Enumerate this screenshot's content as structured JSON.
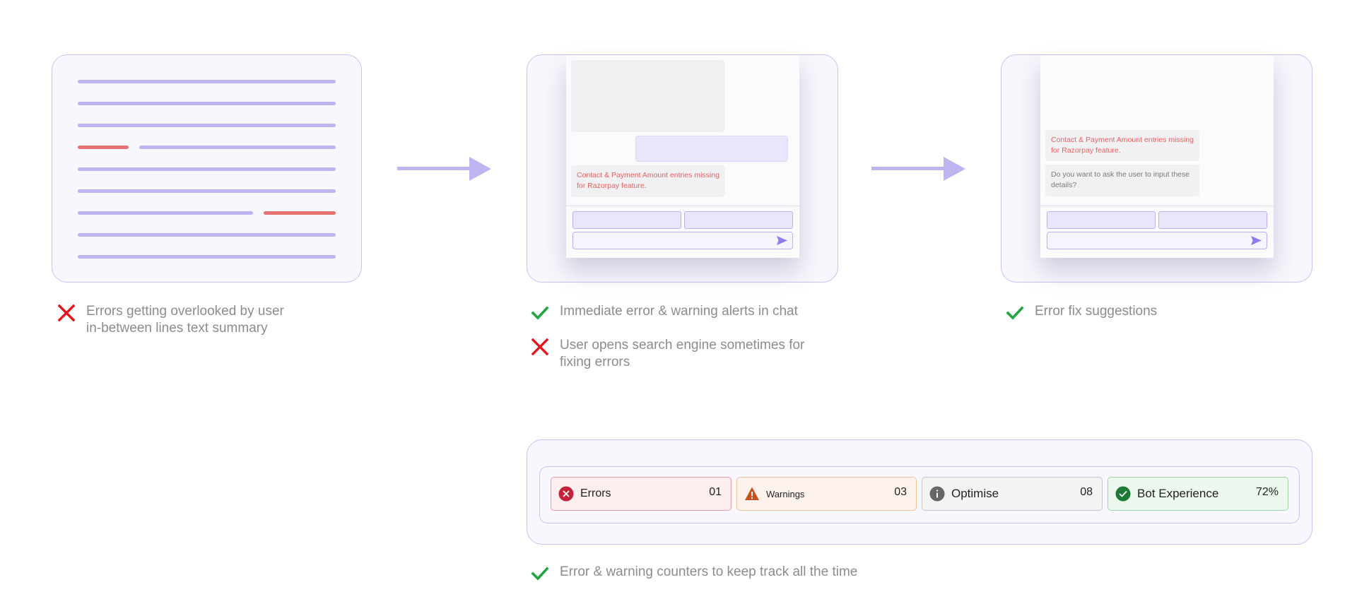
{
  "step1": {
    "note": {
      "icon": "cross-icon",
      "text_line1": "Errors getting overlooked by user",
      "text_line2": "in-between lines text summary"
    }
  },
  "step2": {
    "chat_message": "Contact & Payment Amount entries missing for Razorpay feature.",
    "notes": [
      {
        "icon": "check-icon",
        "text_line1": "Immediate error & warning alerts in chat",
        "text_line2": ""
      },
      {
        "icon": "cross-icon",
        "text_line1": "User opens search engine sometimes for",
        "text_line2": "fixing errors"
      }
    ]
  },
  "step3": {
    "chat_message": "Contact & Payment Amount entries missing for Razorpay feature.",
    "chat_question": "Do you want to ask the user to input these details?",
    "note": {
      "icon": "check-icon",
      "text_line1": "Error fix suggestions"
    }
  },
  "counters": {
    "items": [
      {
        "label": "Errors",
        "value": "01",
        "icon": "error-circle-icon",
        "bg": "#fdeef0",
        "border": "#ec9aa4",
        "icon_color": "#c4213a"
      },
      {
        "label": "Warnings",
        "value": "03",
        "icon": "warning-triangle-icon",
        "bg": "#fdf3ec",
        "border": "#f1c39f",
        "icon_color": "#c8501c"
      },
      {
        "label": "Optimise",
        "value": "08",
        "icon": "info-circle-icon",
        "bg": "#f3f3f4",
        "border": "#c7c7cc",
        "icon_color": "#666666"
      },
      {
        "label": "Bot Experience",
        "value": "72%",
        "icon": "check-circle-icon",
        "bg": "#ecf8ee",
        "border": "#9bd6a5",
        "icon_color": "#1b7a34"
      }
    ],
    "note": {
      "icon": "check-icon",
      "text": "Error & warning counters to keep track all the time"
    }
  },
  "colors": {
    "accent": "#bcb5f0",
    "error_red": "#e5141b",
    "success_green": "#1fa640",
    "error_text": "#e76060"
  }
}
